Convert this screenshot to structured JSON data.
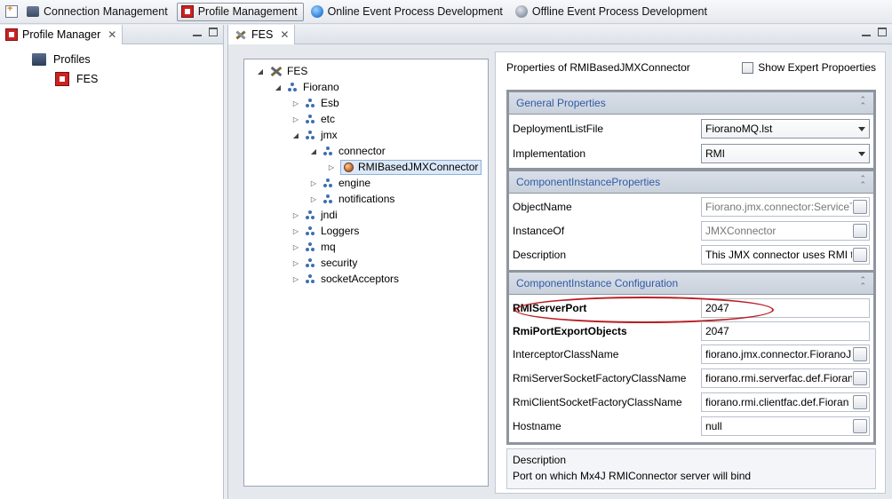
{
  "toolbar": {
    "items": [
      {
        "label": "Connection Management"
      },
      {
        "label": "Profile Management"
      },
      {
        "label": "Online Event Process Development"
      },
      {
        "label": "Offline Event Process Development"
      }
    ]
  },
  "left": {
    "tab": "Profile Manager",
    "close": "✕",
    "tree": [
      {
        "label": "Profiles"
      },
      {
        "label": "FES"
      }
    ]
  },
  "editor": {
    "tab": "FES",
    "close": "✕",
    "tree": {
      "root": "FES",
      "fiorano": "Fiorano",
      "esb": "Esb",
      "etc": "etc",
      "jmx": "jmx",
      "connector": "connector",
      "rmi": "RMIBasedJMXConnector",
      "engine": "engine",
      "notifications": "notifications",
      "jndi": "jndi",
      "loggers": "Loggers",
      "mq": "mq",
      "security": "security",
      "socketAcceptors": "socketAcceptors"
    }
  },
  "props": {
    "title": "Properties of RMIBasedJMXConnector",
    "expert_label": "Show Expert Propoerties",
    "sections": {
      "general": "General Properties",
      "instance": "ComponentInstanceProperties",
      "config": "ComponentInstance Configuration"
    },
    "rows": {
      "deploymentList": {
        "label": "DeploymentListFile",
        "value": "FioranoMQ.lst"
      },
      "implementation": {
        "label": "Implementation",
        "value": "RMI"
      },
      "objectName": {
        "label": "ObjectName",
        "value": "Fiorano.jmx.connector:ServiceT"
      },
      "instanceOf": {
        "label": "InstanceOf",
        "value": "JMXConnector"
      },
      "description": {
        "label": "Description",
        "value": "This JMX connector uses RMI tr"
      },
      "rmiServerPort": {
        "label": "RMIServerPort",
        "value": "2047"
      },
      "rmiPortExport": {
        "label": "RmiPortExportObjects",
        "value": "2047"
      },
      "interceptor": {
        "label": "InterceptorClassName",
        "value": "fiorano.jmx.connector.FioranoJ"
      },
      "serverSocket": {
        "label": "RmiServerSocketFactoryClassName",
        "value": "fiorano.rmi.serverfac.def.Fioran"
      },
      "clientSocket": {
        "label": "RmiClientSocketFactoryClassName",
        "value": "fiorano.rmi.clientfac.def.Fioran"
      },
      "hostname": {
        "label": "Hostname",
        "value": "null"
      }
    },
    "desc": {
      "title": "Description",
      "text": "Port on which Mx4J RMIConnector server will bind"
    }
  }
}
